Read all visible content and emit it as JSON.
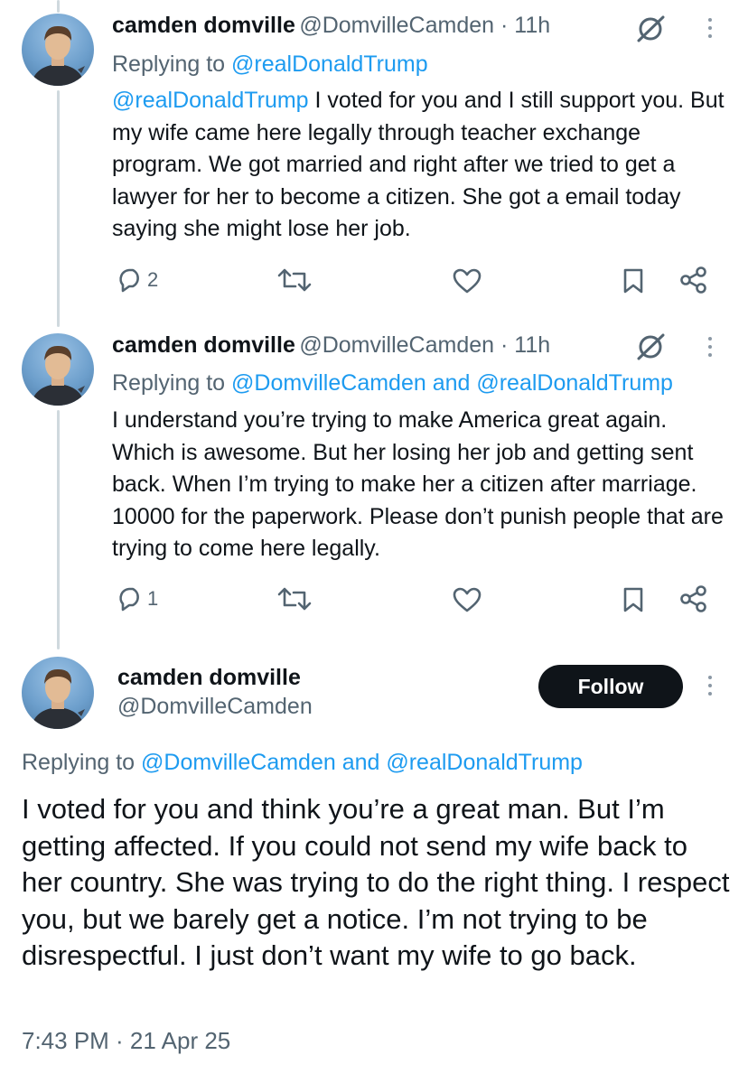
{
  "tweets": [
    {
      "author_name": "camden domville",
      "author_handle": "@DomvilleCamden",
      "time": "11h",
      "replying_prefix": "Replying to ",
      "replying_to": "@realDonaldTrump",
      "text_mention": "@realDonaldTrump",
      "text": " I voted for you and I still support you. But my wife came here legally through teacher exchange program. We got married and right after we tried to get a lawyer for her to become a citizen. She got a email today saying she might lose her job.",
      "reply_count": "2"
    },
    {
      "author_name": "camden domville",
      "author_handle": "@DomvilleCamden",
      "time": "11h",
      "replying_prefix": "Replying to ",
      "replying_to": "@DomvilleCamden and @realDonaldTrump",
      "text": "I understand you’re trying to make America great again. Which is awesome. But her losing her job and getting sent back. When I’m trying to make her a citizen after marriage. 10000 for the paperwork. Please don’t punish people that are trying to come here legally.",
      "reply_count": "1"
    }
  ],
  "main_tweet": {
    "author_name": "camden domville",
    "author_handle": "@DomvilleCamden",
    "follow_label": "Follow",
    "replying_prefix": "Replying to ",
    "replying_to": "@DomvilleCamden and @realDonaldTrump",
    "text": "I voted for you and think you’re a great man. But I’m getting affected. If you could not send my wife back to her country. She was trying to do the right thing. I respect you, but we barely get a notice. I’m not trying to be disrespectful. I just don’t want my wife to go back.",
    "timestamp": "7:43 PM · 21 Apr 25"
  },
  "colors": {
    "text": "#0f1419",
    "secondary": "#536471",
    "link": "#1d9bf0",
    "thread_line": "#cfd9de",
    "follow_bg": "#0f1419"
  },
  "icons": [
    "grok-icon",
    "more-icon",
    "reply-icon",
    "retweet-icon",
    "like-icon",
    "bookmark-icon",
    "share-icon"
  ]
}
